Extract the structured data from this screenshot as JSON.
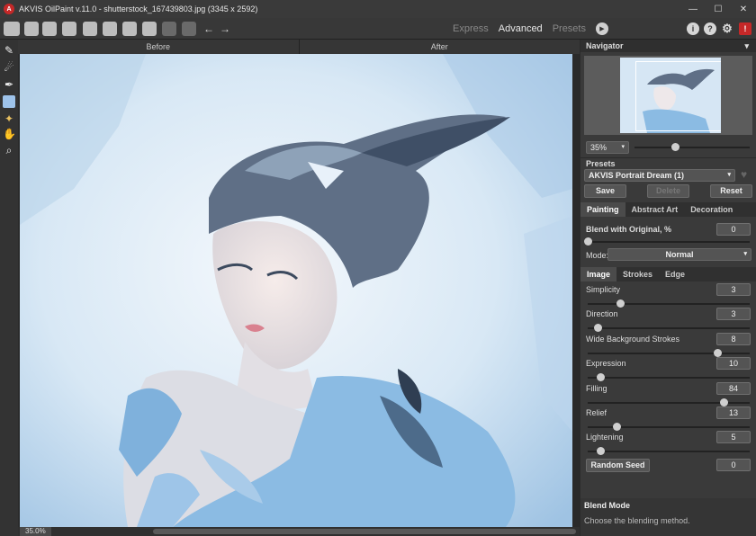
{
  "window": {
    "title": "AKVIS OilPaint v.11.0 - shutterstock_167439803.jpg (3345 x 2592)",
    "app_icon_letter": "A",
    "minimize": "—",
    "maximize": "☐",
    "close": "✕"
  },
  "toolbar": {
    "modes": [
      "Express",
      "Advanced",
      "Presets"
    ],
    "active_mode": "Advanced",
    "play_icon": "▶",
    "undo_icon": "←",
    "redo_icon": "→",
    "info_icon": "i",
    "help_icon": "?",
    "settings_icon": "⚙",
    "notify_icon": "!"
  },
  "tools": {
    "brush": "✎",
    "smudge": "☄",
    "pen": "✒",
    "erase": "▭",
    "stamp": "✦",
    "hand": "✋",
    "zoom": "⌕"
  },
  "canvas": {
    "before_label": "Before",
    "after_label": "After",
    "zoom_status": "35.0%"
  },
  "navigator": {
    "title": "Navigator",
    "collapse_icon": "▾",
    "zoom_value": "35%",
    "zoom_level": 0.35
  },
  "presets": {
    "label": "Presets",
    "selected": "AKVIS Portrait Dream (1)",
    "dropdown_icon": "▾",
    "favorite_icon": "♥",
    "save_label": "Save",
    "delete_label": "Delete",
    "reset_label": "Reset"
  },
  "main_tabs": [
    "Painting",
    "Abstract Art",
    "Decoration"
  ],
  "blend": {
    "label": "Blend with Original, %",
    "value": "0",
    "mode_label": "Mode:",
    "mode_value": "Normal"
  },
  "sub_tabs": [
    "Image",
    "Strokes",
    "Edge"
  ],
  "params": [
    {
      "label": "Simplicity",
      "value": "3",
      "fraction": 0.2
    },
    {
      "label": "Direction",
      "value": "3",
      "fraction": 0.06
    },
    {
      "label": "Wide Background Strokes",
      "value": "8",
      "fraction": 0.8
    },
    {
      "label": "Expression",
      "value": "10",
      "fraction": 0.08
    },
    {
      "label": "Filling",
      "value": "84",
      "fraction": 0.84
    },
    {
      "label": "Relief",
      "value": "13",
      "fraction": 0.18
    },
    {
      "label": "Lightening",
      "value": "5",
      "fraction": 0.08
    }
  ],
  "random_seed": {
    "label": "Random Seed",
    "value": "0"
  },
  "blend_mode_help": {
    "title": "Blend Mode",
    "text": "Choose the blending method."
  }
}
